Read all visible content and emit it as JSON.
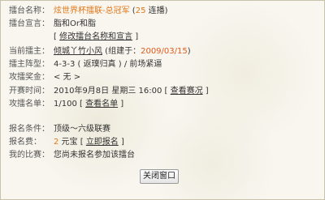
{
  "rows": {
    "name": {
      "label": "擂台名称：",
      "value": "炫世界杯擂联-总冠军",
      "count_open": " (",
      "count": "25",
      "count_suffix": " 连播)"
    },
    "slogan": {
      "label": "擂台宣言：",
      "value": "脂和Or和脂"
    },
    "edit": {
      "open": "[ ",
      "link": "修改擂台名称和宣言",
      "close": " ]"
    },
    "owner": {
      "label": "当前擂主：",
      "name": "倾城丫竹小风",
      "built_prefix": " (组建于：",
      "built_date": "2009/03/15",
      "built_suffix": ")"
    },
    "formation": {
      "label": "擂主阵型：",
      "value": "4-3-3 ( 返璞归真 ) / 前场紧逼"
    },
    "prize": {
      "label": "攻擂奖金：",
      "value": "< 无 >"
    },
    "start": {
      "label": "开赛时间：",
      "value": "2010年9月8日 星期三 16:00 [ ",
      "link": "查看赛况",
      "close": " ]"
    },
    "roster": {
      "label": "攻擂名单：",
      "value": "1/100 [ ",
      "link": "查看名单",
      "close": " ]"
    },
    "condition": {
      "label": "报名条件：",
      "value": "顶级～六级联赛"
    },
    "fee": {
      "label": "报名费：",
      "amount": "2",
      "unit": " 元宝 [ ",
      "link": "立即报名",
      "close": " ]"
    },
    "mine": {
      "label": "我的比赛：",
      "value": "您尚未报名参加该擂台"
    }
  },
  "close_button": "关闭窗口",
  "colors": {
    "accent_orange": "#e0781a",
    "accent_red": "#e05a1a"
  }
}
